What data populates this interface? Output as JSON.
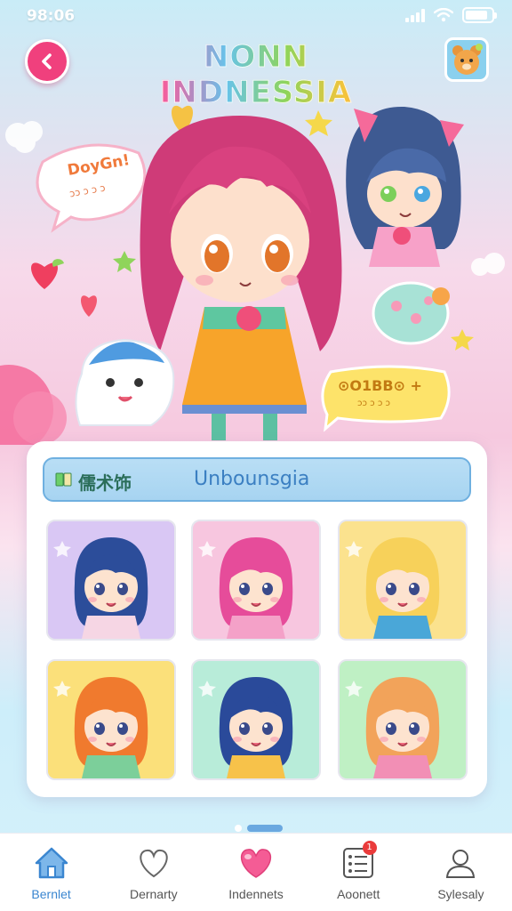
{
  "status": {
    "time": "98:06"
  },
  "header": {
    "title": "NONN INDNESSIA"
  },
  "hero": {
    "bubble_left_text": "DoyGn!",
    "bubble_left_sub": "ɔɔ ɔ ɔ ɔ",
    "bubble_right_text": "⊙O1BB⊙ +",
    "bubble_right_sub": "ɔɔ ɔ ɔ ɔ"
  },
  "search": {
    "cjk_label": "儒术饰",
    "value": "Unbounsgia"
  },
  "grid": [
    {
      "bg": "#d9c7f4",
      "hair": "#2c4d9a",
      "outfit": "#f6d6e4"
    },
    {
      "bg": "#f7c6df",
      "hair": "#e64c9a",
      "outfit": "#f4a1c8"
    },
    {
      "bg": "#fbe28e",
      "hair": "#f7d15a",
      "outfit": "#4aa7d8"
    },
    {
      "bg": "#fbe07a",
      "hair": "#f07a2e",
      "outfit": "#7ccf9a"
    },
    {
      "bg": "#b8ecd9",
      "hair": "#2a4a9a",
      "outfit": "#f7c24a"
    },
    {
      "bg": "#bff0c4",
      "hair": "#f2a35a",
      "outfit": "#f28fb5"
    }
  ],
  "tabbar": {
    "items": [
      {
        "label": "Bernlet",
        "icon": "home-icon",
        "active": true
      },
      {
        "label": "Dernarty",
        "icon": "heart-outline-icon"
      },
      {
        "label": "Indennets",
        "icon": "heart-icon"
      },
      {
        "label": "Aoonett",
        "icon": "list-icon",
        "badge": "1"
      },
      {
        "label": "Sylesaly",
        "icon": "user-icon"
      }
    ]
  },
  "colors": {
    "accent": "#f0407d",
    "blue": "#3a86d0"
  }
}
